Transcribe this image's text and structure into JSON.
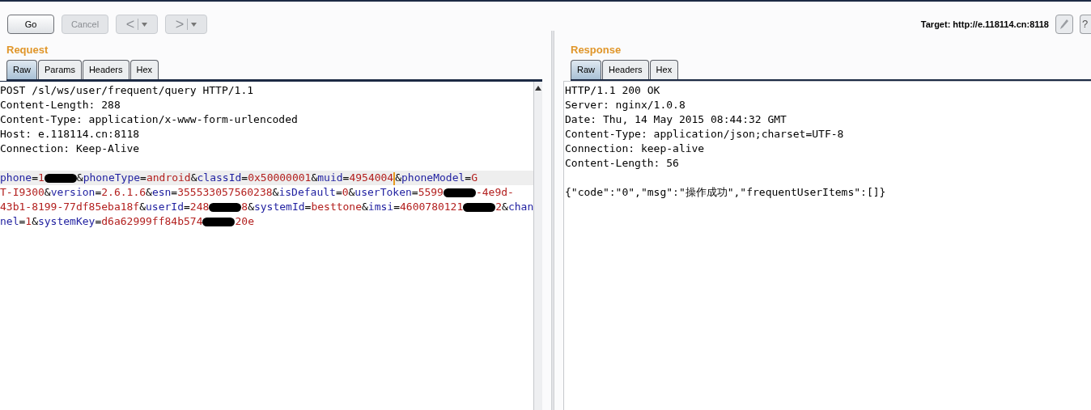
{
  "toolbar": {
    "buttons": [
      {
        "label": "Go",
        "disabled": false
      },
      {
        "label": "Cancel",
        "disabled": true
      }
    ],
    "history_buttons": [
      {
        "label": "<",
        "disabled": true
      },
      {
        "label": ">",
        "disabled": true
      }
    ],
    "target": "Target: http://e.118114.cn:8118",
    "help_button": "?"
  },
  "request": {
    "heading": "Request",
    "tabs": [
      {
        "label": "Raw",
        "selected": true
      },
      {
        "label": "Params",
        "selected": false
      },
      {
        "label": "Headers",
        "selected": false
      },
      {
        "label": "Hex",
        "selected": false
      }
    ],
    "header_lines": [
      "POST /sl/ws/user/frequent/query HTTP/1.1",
      "Content-Length: 288",
      "Content-Type: application/x-www-form-urlencoded",
      "Host: e.118114.cn:8118",
      "Connection: Keep-Alive"
    ],
    "body_lines": [
      {
        "highlighted": true,
        "segments": [
          {
            "kind": "name",
            "text": "phone"
          },
          {
            "kind": "sep",
            "text": "="
          },
          {
            "kind": "value",
            "text": "1"
          },
          {
            "kind": "redaction"
          },
          {
            "kind": "sep",
            "text": "&"
          },
          {
            "kind": "name",
            "text": "phoneType"
          },
          {
            "kind": "sep",
            "text": "="
          },
          {
            "kind": "value",
            "text": "android"
          },
          {
            "kind": "sep",
            "text": "&"
          },
          {
            "kind": "name",
            "text": "classId"
          },
          {
            "kind": "sep",
            "text": "="
          },
          {
            "kind": "value",
            "text": "0x50000001"
          },
          {
            "kind": "sep",
            "text": "&"
          },
          {
            "kind": "name",
            "text": "muid"
          },
          {
            "kind": "sep",
            "text": "="
          },
          {
            "kind": "value",
            "text": "4954004"
          },
          {
            "kind": "caret"
          },
          {
            "kind": "sep",
            "text": "&"
          },
          {
            "kind": "name",
            "text": "phoneModel"
          },
          {
            "kind": "sep",
            "text": "="
          },
          {
            "kind": "value",
            "text": "G"
          }
        ]
      },
      {
        "highlighted": false,
        "segments": [
          {
            "kind": "value",
            "text": "T-I9300"
          },
          {
            "kind": "sep",
            "text": "&"
          },
          {
            "kind": "name",
            "text": "version"
          },
          {
            "kind": "sep",
            "text": "="
          },
          {
            "kind": "value",
            "text": "2.6.1.6"
          },
          {
            "kind": "sep",
            "text": "&"
          },
          {
            "kind": "name",
            "text": "esn"
          },
          {
            "kind": "sep",
            "text": "="
          },
          {
            "kind": "value",
            "text": "355533057560238"
          },
          {
            "kind": "sep",
            "text": "&"
          },
          {
            "kind": "name",
            "text": "isDefault"
          },
          {
            "kind": "sep",
            "text": "="
          },
          {
            "kind": "value",
            "text": "0"
          },
          {
            "kind": "sep",
            "text": "&"
          },
          {
            "kind": "name",
            "text": "userToken"
          },
          {
            "kind": "sep",
            "text": "="
          },
          {
            "kind": "value",
            "text": "5599"
          },
          {
            "kind": "redaction"
          },
          {
            "kind": "value",
            "text": "-4e9d-"
          }
        ]
      },
      {
        "highlighted": false,
        "segments": [
          {
            "kind": "value",
            "text": "43b1-8199-77df85eba18f"
          },
          {
            "kind": "sep",
            "text": "&"
          },
          {
            "kind": "name",
            "text": "userId"
          },
          {
            "kind": "sep",
            "text": "="
          },
          {
            "kind": "value",
            "text": "248"
          },
          {
            "kind": "redaction"
          },
          {
            "kind": "value",
            "text": "8"
          },
          {
            "kind": "sep",
            "text": "&"
          },
          {
            "kind": "name",
            "text": "systemId"
          },
          {
            "kind": "sep",
            "text": "="
          },
          {
            "kind": "value",
            "text": "besttone"
          },
          {
            "kind": "sep",
            "text": "&"
          },
          {
            "kind": "name",
            "text": "imsi"
          },
          {
            "kind": "sep",
            "text": "="
          },
          {
            "kind": "value",
            "text": "4600780121"
          },
          {
            "kind": "redaction"
          },
          {
            "kind": "value",
            "text": "2"
          },
          {
            "kind": "sep",
            "text": "&"
          },
          {
            "kind": "name",
            "text": "chan"
          }
        ]
      },
      {
        "highlighted": false,
        "segments": [
          {
            "kind": "name",
            "text": "nel"
          },
          {
            "kind": "sep",
            "text": "="
          },
          {
            "kind": "value",
            "text": "1"
          },
          {
            "kind": "sep",
            "text": "&"
          },
          {
            "kind": "name",
            "text": "systemKey"
          },
          {
            "kind": "sep",
            "text": "="
          },
          {
            "kind": "value",
            "text": "d6a62999ff84b574"
          },
          {
            "kind": "redaction"
          },
          {
            "kind": "value",
            "text": "20e"
          }
        ]
      }
    ]
  },
  "response": {
    "heading": "Response",
    "tabs": [
      {
        "label": "Raw",
        "selected": true
      },
      {
        "label": "Headers",
        "selected": false
      },
      {
        "label": "Hex",
        "selected": false
      }
    ],
    "header_lines": [
      "HTTP/1.1 200 OK",
      "Server: nginx/1.0.8",
      "Date: Thu, 14 May 2015 08:44:32 GMT",
      "Content-Type: application/json;charset=UTF-8",
      "Connection: keep-alive",
      "Content-Length: 56"
    ],
    "body": "{\"code\":\"0\",\"msg\":\"操作成功\",\"frequentUserItems\":[]}"
  }
}
